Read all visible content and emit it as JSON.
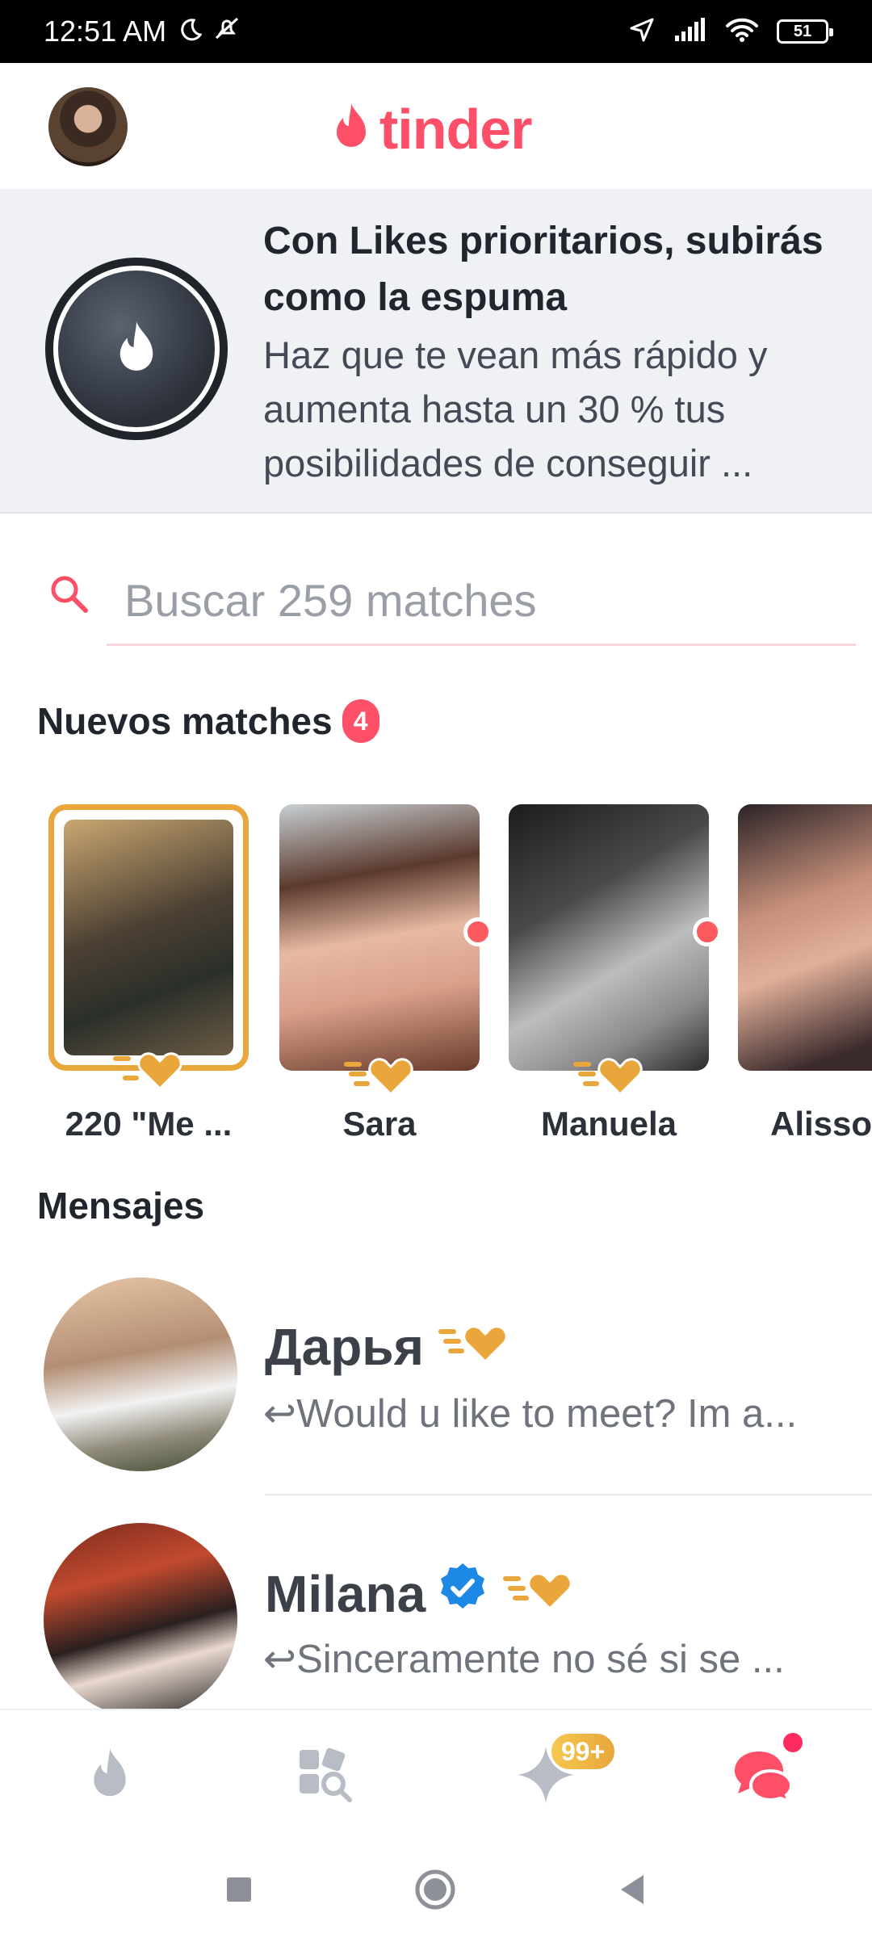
{
  "status_bar": {
    "time": "12:51 AM",
    "battery": "51"
  },
  "header": {
    "logo_text": "tinder",
    "brand_color": "#fd4f68"
  },
  "promo": {
    "title": "Con Likes prioritarios, subirás como la espuma",
    "body": "Haz que te vean más rápido y aumenta hasta un 30 % tus posibilidades de conseguir ..."
  },
  "search": {
    "placeholder": "Buscar 259 matches"
  },
  "new_matches": {
    "title": "Nuevos matches",
    "count": "4",
    "items": [
      {
        "name": "220 \"Me ..."
      },
      {
        "name": "Sara"
      },
      {
        "name": "Manuela"
      },
      {
        "name": "Alisso"
      }
    ]
  },
  "messages": {
    "title": "Mensajes",
    "items": [
      {
        "name": "Дарья",
        "preview": "Would u like to meet? Im a..."
      },
      {
        "name": "Milana",
        "preview": "Sinceramente no sé si se ..."
      }
    ]
  },
  "bottom_nav": {
    "likes_badge": "99+",
    "items": [
      "flame-icon",
      "explore-icon",
      "sparkle-icon",
      "chat-icon"
    ]
  },
  "colors": {
    "accent": "#fd4f68",
    "gold": "#e8a63b",
    "verified": "#1e88e5"
  }
}
